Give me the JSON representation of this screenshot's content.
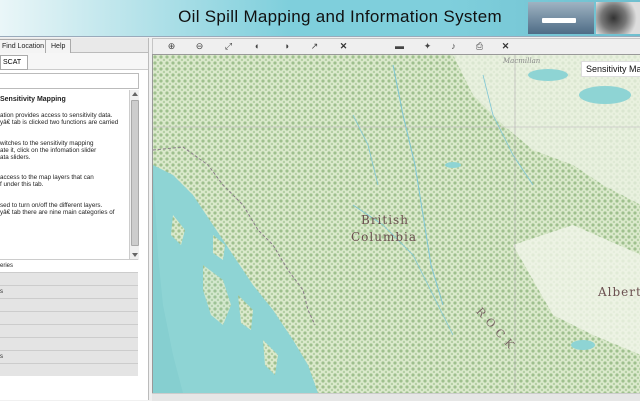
{
  "app": {
    "title": "Oil Spill Mapping and Information System"
  },
  "left_panel": {
    "tabs": [
      "Find Location",
      "Help"
    ],
    "subtab": "SCAT",
    "info": {
      "heading": "Sensitivity Mapping",
      "lines": [
        "ation provides access to sensitivity data.",
        "yâ€ tab is clicked two functions are carried",
        "",
        "witches to the sensitivity mapping",
        "ate it, click on the infomation slider",
        "ata sliders.",
        "",
        "access to the map layers that can",
        "f under this tab.",
        "",
        "sed to turn on/off the different layers.",
        "yâ€ tab there are nine main categories of"
      ]
    },
    "categories": [
      "eries",
      "",
      "s",
      "",
      "",
      "",
      "",
      "s",
      ""
    ]
  },
  "toolbar": {
    "icons": [
      "zoom-in-icon",
      "zoom-out-icon",
      "full-extent-icon",
      "previous-extent-icon",
      "next-extent-icon",
      "identify-icon",
      "close-icon",
      "layer-icon",
      "draw-icon",
      "measure-icon",
      "print-icon",
      "close-icon"
    ],
    "glyphs": [
      "⊕",
      "⊖",
      "⤢",
      "◐",
      "◑",
      "↗",
      "✕",
      "▬",
      "✦",
      "♪",
      "⎙",
      "✕"
    ]
  },
  "map": {
    "title": "Sensitivity Mapping",
    "labels": {
      "bc1": "British",
      "bc2": "Columbia",
      "alberta": "Alberta",
      "rocky": "R  O  C  K",
      "yukon": "Macmillan"
    },
    "colors": {
      "water": "#8ed4d4",
      "land": "#dfeccf",
      "forest": "#aac99a"
    }
  }
}
